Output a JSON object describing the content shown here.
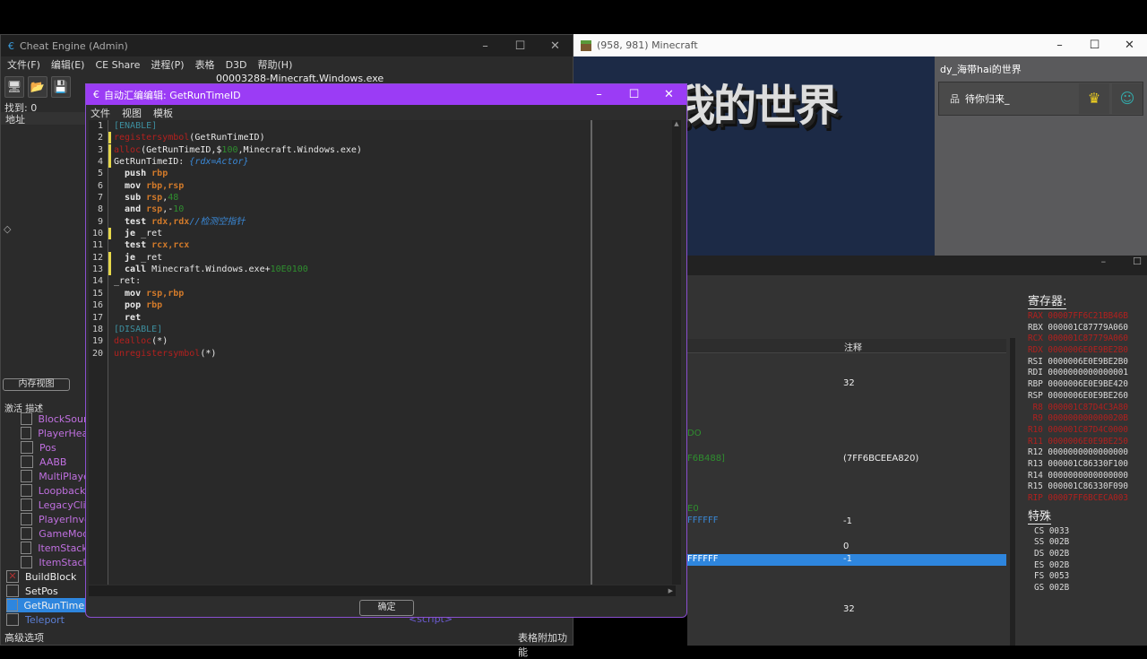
{
  "ce": {
    "title": "Cheat Engine (Admin)",
    "menu": [
      "文件(F)",
      "编辑(E)",
      "CE Share",
      "进程(P)",
      "表格",
      "D3D",
      "帮助(H)"
    ],
    "process": "00003288-Minecraft.Windows.exe",
    "found": "找到: 0",
    "address_header": "地址",
    "memview_btn": "内存视图",
    "col_active": "激活",
    "col_desc": "描述",
    "advanced": "高级选项",
    "table_extras": "表格附加功能",
    "script_tag": "<script>",
    "entries": [
      {
        "label": "BlockSourc",
        "group": true
      },
      {
        "label": "PlayerHead",
        "group": true
      },
      {
        "label": "Pos",
        "group": true
      },
      {
        "label": "AABB",
        "group": true
      },
      {
        "label": "MultiPlaye",
        "group": true
      },
      {
        "label": "LoopbackP",
        "group": true
      },
      {
        "label": "LegacyClie",
        "group": true
      },
      {
        "label": "PlayerInve",
        "group": true
      },
      {
        "label": "GameMod",
        "group": true
      },
      {
        "label": "ItemStackB",
        "group": true
      },
      {
        "label": "ItemStack",
        "group": true
      },
      {
        "label": "BuildBlock",
        "checked": true
      },
      {
        "label": "SetPos"
      },
      {
        "label": "GetRunTimeID",
        "selected": true
      },
      {
        "label": "Teleport",
        "blue": true
      }
    ]
  },
  "aa": {
    "title": "自动汇编编辑: GetRunTimeID",
    "menu": [
      "文件",
      "视图",
      "模板"
    ],
    "ok": "确定",
    "modified_lines": [
      2,
      3,
      4,
      10,
      12,
      13
    ],
    "lines": [
      [
        [
          "t",
          "[ENABLE]"
        ]
      ],
      [
        [
          "k",
          "registersymbol"
        ],
        [
          "",
          "(GetRunTimeID)"
        ]
      ],
      [
        [
          "k",
          "alloc"
        ],
        [
          "",
          "(GetRunTimeID,$"
        ],
        [
          "n",
          "100"
        ],
        [
          "",
          ",Minecraft.Windows.exe)"
        ]
      ],
      [
        [
          "",
          "GetRunTimeID: "
        ],
        [
          "c",
          "{rdx=Actor}"
        ]
      ],
      [
        [
          "b",
          "  push "
        ],
        [
          "r",
          "rbp"
        ]
      ],
      [
        [
          "b",
          "  mov "
        ],
        [
          "r",
          "rbp,rsp"
        ]
      ],
      [
        [
          "b",
          "  sub "
        ],
        [
          "r",
          "rsp"
        ],
        [
          "",
          ","
        ],
        [
          "n",
          "48"
        ]
      ],
      [
        [
          "b",
          "  and "
        ],
        [
          "r",
          "rsp"
        ],
        [
          "",
          ",-"
        ],
        [
          "n",
          "10"
        ]
      ],
      [
        [
          "b",
          "  test "
        ],
        [
          "r",
          "rdx,rdx"
        ],
        [
          "c",
          "//检测空指针"
        ]
      ],
      [
        [
          "b",
          "  je "
        ],
        [
          "",
          "_ret"
        ]
      ],
      [
        [
          "b",
          "  test "
        ],
        [
          "r",
          "rcx,rcx"
        ]
      ],
      [
        [
          "b",
          "  je "
        ],
        [
          "",
          "_ret"
        ]
      ],
      [
        [
          "b",
          "  call "
        ],
        [
          "",
          "Minecraft.Windows.exe+"
        ],
        [
          "n",
          "10E0100"
        ]
      ],
      [
        [
          "",
          "_ret:"
        ]
      ],
      [
        [
          "b",
          "  mov "
        ],
        [
          "r",
          "rsp,rbp"
        ]
      ],
      [
        [
          "b",
          "  pop "
        ],
        [
          "r",
          "rbp"
        ]
      ],
      [
        [
          "b",
          "  ret"
        ]
      ],
      [
        [
          "t",
          "[DISABLE]"
        ]
      ],
      [
        [
          "k",
          "dealloc"
        ],
        [
          "",
          "(*)"
        ]
      ],
      [
        [
          "k",
          "unregistersymbol"
        ],
        [
          "",
          "(*)"
        ]
      ]
    ]
  },
  "mc": {
    "title": "(958, 981) Minecraft",
    "logo": "我的世界",
    "world": "dy_海带hai的世界",
    "server": "待你归来_"
  },
  "mv": {
    "comment_header": "注释",
    "frag": [
      {
        "t": "DO",
        "c": "#2f8f2f"
      },
      {
        "t": "F6B488]",
        "c": "#2f8f2f"
      },
      {
        "t": "E0",
        "c": "#2f8f2f"
      },
      {
        "t": "FFFFFF",
        "c": "#3a88d6"
      },
      {
        "t": "FFFFFF",
        "c": "#ffffff"
      }
    ],
    "comments": [
      "32",
      "(7FF6BCEEA820)",
      "-1",
      "0",
      "-1",
      "32"
    ],
    "reg_title": "寄存器:",
    "special_title": "特殊",
    "regs": [
      [
        "RAX",
        "00007FF6C21BB46B",
        1
      ],
      [
        "RBX",
        "000001C87779A060",
        0
      ],
      [
        "RCX",
        "000001C87779A060",
        1
      ],
      [
        "RDX",
        "0000006E0E9BE2B0",
        1
      ],
      [
        "RSI",
        "0000006E0E9BE2B0",
        0
      ],
      [
        "RDI",
        "0000000000000001",
        0
      ],
      [
        "RBP",
        "0000006E0E9BE420",
        0
      ],
      [
        "RSP",
        "0000006E0E9BE260",
        0
      ],
      [
        " R8",
        "000001C87D4C3A80",
        1
      ],
      [
        " R9",
        "000000000000020B",
        1
      ],
      [
        "R10",
        "000001C87D4C0000",
        1
      ],
      [
        "R11",
        "0000006E0E9BE250",
        1
      ],
      [
        "R12",
        "0000000000000000",
        0
      ],
      [
        "R13",
        "000001C86330F100",
        0
      ],
      [
        "R14",
        "0000000000000000",
        0
      ],
      [
        "R15",
        "000001C86330F090",
        0
      ],
      [
        "RIP",
        "00007FF6BCECA003",
        1
      ]
    ],
    "segs": [
      [
        "CS",
        "0033"
      ],
      [
        "SS",
        "002B"
      ],
      [
        "DS",
        "002B"
      ],
      [
        "ES",
        "002B"
      ],
      [
        "FS",
        "0053"
      ],
      [
        "GS",
        "002B"
      ]
    ]
  }
}
